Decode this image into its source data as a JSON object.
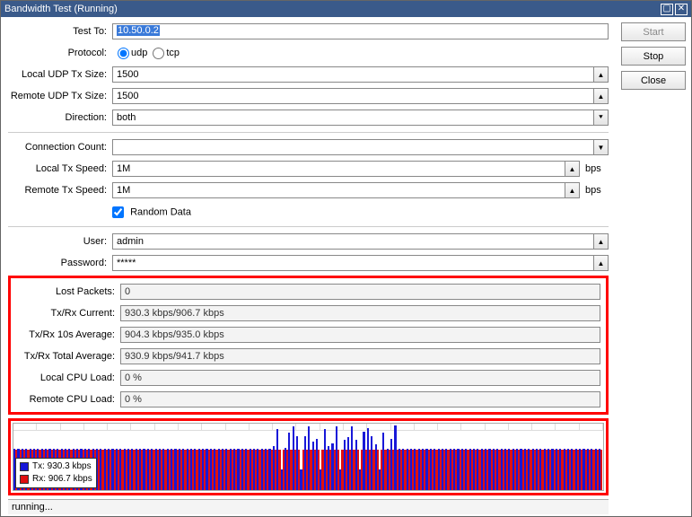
{
  "window": {
    "title": "Bandwidth Test (Running)"
  },
  "side": {
    "start": "Start",
    "stop": "Stop",
    "close": "Close"
  },
  "labels": {
    "testTo": "Test To:",
    "protocol": "Protocol:",
    "localUdpTx": "Local UDP Tx Size:",
    "remoteUdpTx": "Remote UDP Tx Size:",
    "direction": "Direction:",
    "connCount": "Connection Count:",
    "localTxSpeed": "Local Tx Speed:",
    "remoteTxSpeed": "Remote Tx Speed:",
    "randomData": "Random Data",
    "user": "User:",
    "password": "Password:",
    "lostPackets": "Lost Packets:",
    "txrxCurrent": "Tx/Rx Current:",
    "txrx10s": "Tx/Rx 10s Average:",
    "txrxTotal": "Tx/Rx Total Average:",
    "localCpu": "Local CPU Load:",
    "remoteCpu": "Remote CPU Load:",
    "bps": "bps"
  },
  "values": {
    "testTo": "10.50.0.2",
    "protoUdp": "udp",
    "protoTcp": "tcp",
    "localUdpTx": "1500",
    "remoteUdpTx": "1500",
    "direction": "both",
    "connCount": "",
    "localTxSpeed": "1M",
    "remoteTxSpeed": "1M",
    "randomChecked": true,
    "user": "admin",
    "password": "*****",
    "lostPackets": "0",
    "txrxCurrent": "930.3 kbps/906.7 kbps",
    "txrx10s": "904.3 kbps/935.0 kbps",
    "txrxTotal": "930.9 kbps/941.7 kbps",
    "localCpu": "0 %",
    "remoteCpu": "0 %"
  },
  "legend": {
    "tx": "Tx:  930.3 kbps",
    "rx": "Rx:  906.7 kbps"
  },
  "status": "running...",
  "chart_data": {
    "type": "bar",
    "title": "Bandwidth Tx/Rx over time",
    "xlabel": "",
    "ylabel": "kbps",
    "ylim": [
      0,
      1500
    ],
    "categories_count": 150,
    "series": [
      {
        "name": "Tx",
        "color": "#1818d8",
        "approx_value": 930,
        "note": "mostly steady ~930 kbps with bursts up to ~1450 kbps around middle region"
      },
      {
        "name": "Rx",
        "color": "#e01010",
        "approx_value": 907,
        "note": "steady ~907 kbps throughout"
      }
    ]
  }
}
